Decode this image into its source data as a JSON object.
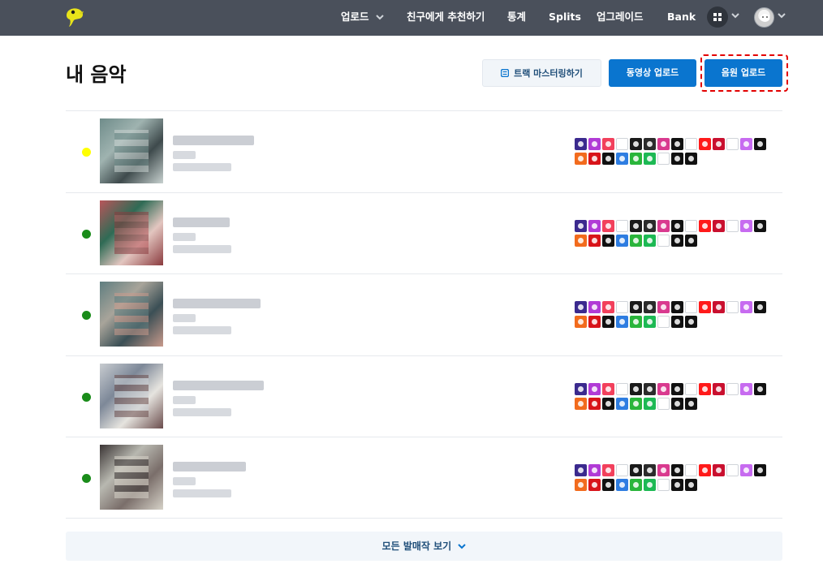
{
  "nav": {
    "items": [
      {
        "label": "업로드",
        "has_dropdown": true
      },
      {
        "label": "친구에게 추천하기"
      },
      {
        "label": "통계"
      },
      {
        "label": "Splits"
      },
      {
        "label": "업그레이드"
      },
      {
        "label": "Bank"
      }
    ],
    "apps_icon": "grid-icon",
    "avatar_icon": "user-avatar"
  },
  "header": {
    "title": "내 음악",
    "mastering_label": "트랙 마스터링하기",
    "video_upload_label": "동영상 업로드",
    "audio_upload_label": "음원 업로드"
  },
  "colors": {
    "nav_bg": "#4a505b",
    "primary": "#0a75cf",
    "status_pending": "#ffff00",
    "status_live": "#1a8c1a",
    "highlight": "#e30000"
  },
  "releases": [
    {
      "status": "pending",
      "status_color": "#ffff00",
      "cover": [
        "#6f8c8a",
        "#9fb3b0",
        "#3e4a4c",
        "#c8d2d0"
      ],
      "title_obscured": true
    },
    {
      "status": "live",
      "status_color": "#1a8c1a",
      "cover": [
        "#b8555a",
        "#2f6b55",
        "#e3c6c0",
        "#8a3a3e"
      ],
      "title_obscured": true
    },
    {
      "status": "live",
      "status_color": "#1a8c1a",
      "cover": [
        "#5f7e80",
        "#a8a49a",
        "#3b4f55",
        "#c89a8c"
      ],
      "title_obscured": true
    },
    {
      "status": "live",
      "status_color": "#1a8c1a",
      "cover": [
        "#c8ccd0",
        "#7d8898",
        "#e6e4df",
        "#6a4c4c"
      ],
      "title_obscured": true
    },
    {
      "status": "live",
      "status_color": "#1a8c1a",
      "cover": [
        "#3a3434",
        "#b8b8b0",
        "#7a6e6a",
        "#d6d2c8"
      ],
      "title_obscured": true
    }
  ],
  "store_icons_row1": [
    {
      "name": "amazon-music-icon",
      "color": "#3b2a8e"
    },
    {
      "name": "anghami-icon",
      "color": "#b13bd6"
    },
    {
      "name": "apple-music-icon",
      "color": "#f2405c"
    },
    {
      "name": "audiomack-icon",
      "color": "#ffffff"
    },
    {
      "name": "boomplay-icon",
      "color": "#1a1a1a"
    },
    {
      "name": "deezer-icon",
      "color": "#2b2b2b"
    },
    {
      "name": "instagram-icon",
      "color": "#d93a8f"
    },
    {
      "name": "jiosaavn-icon",
      "color": "#111111"
    },
    {
      "name": "flo-icon",
      "color": "#ffffff"
    },
    {
      "name": "youtube-icon",
      "color": "#ff1a1a"
    },
    {
      "name": "iheartradio-icon",
      "color": "#c9102f"
    },
    {
      "name": "kkbox-icon",
      "color": "#ffffff"
    },
    {
      "name": "itunes-icon",
      "color": "#c76bf0"
    },
    {
      "name": "napster-icon",
      "color": "#111111"
    }
  ],
  "store_icons_row2": [
    {
      "name": "soundcloud-icon",
      "color": "#f26b1d"
    },
    {
      "name": "netease-icon",
      "color": "#d8141a"
    },
    {
      "name": "qobuz-icon",
      "color": "#111111"
    },
    {
      "name": "pandora-icon",
      "color": "#2e7de1"
    },
    {
      "name": "melon-icon",
      "color": "#2ab53b"
    },
    {
      "name": "spotify-icon",
      "color": "#1db954"
    },
    {
      "name": "tidal-icon",
      "color": "#ffffff"
    },
    {
      "name": "tencent-icon",
      "color": "#111111"
    },
    {
      "name": "tiktok-icon",
      "color": "#111111"
    }
  ],
  "footer": {
    "show_all_label": "모든 발매작 보기"
  }
}
